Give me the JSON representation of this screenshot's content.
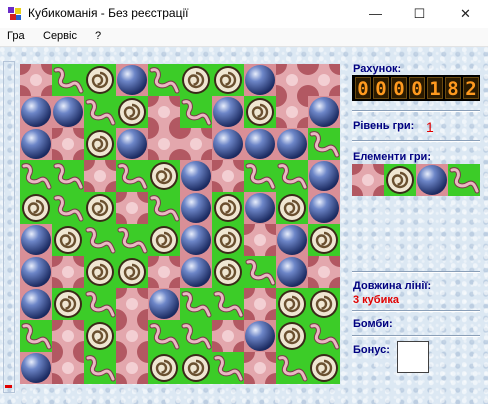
{
  "window": {
    "title": "Кубикоманія - Без реєстрації",
    "minimize": "—",
    "maximize": "☐",
    "close": "✕"
  },
  "menu": [
    "Гра",
    "Сервіс",
    "?"
  ],
  "panel": {
    "score_label": "Рахунок:",
    "score_digits": [
      "0",
      "0",
      "0",
      "0",
      "1",
      "8",
      "2"
    ],
    "level_label": "Рівень гри:",
    "level_value": "1",
    "elements_label": "Елементи гри:",
    "elements": [
      "pink",
      "swirl",
      "ball",
      "worm"
    ],
    "line_length_label": "Довжина лінії:",
    "line_length_value": "3 кубика",
    "bombs_label": "Бомби:",
    "bonus_label": "Бонус:"
  },
  "board": {
    "size": 10,
    "legend": {
      "P": "pink",
      "S": "swirl",
      "B": "ball",
      "W": "worm"
    },
    "rows": [
      "PWSBWSSBP",
      "BBWSPWBSPB",
      "BPSBPPBBBW",
      "WWPWSBPWWB",
      "SWSPWBSBSB",
      "BSWWSBSPBS",
      "BPSSPBSWBP",
      "BSWPBWWPSS",
      "WPSPWWPBSW",
      "BPWPSSWPWS"
    ]
  },
  "colors": {
    "cell_green": "#3ccc28",
    "cell_pink": "#d98f97",
    "ball_blue": "#2d4a9a",
    "score_digit": "#ff9a1f",
    "label_text": "#000080",
    "accent_red": "#e00000"
  }
}
